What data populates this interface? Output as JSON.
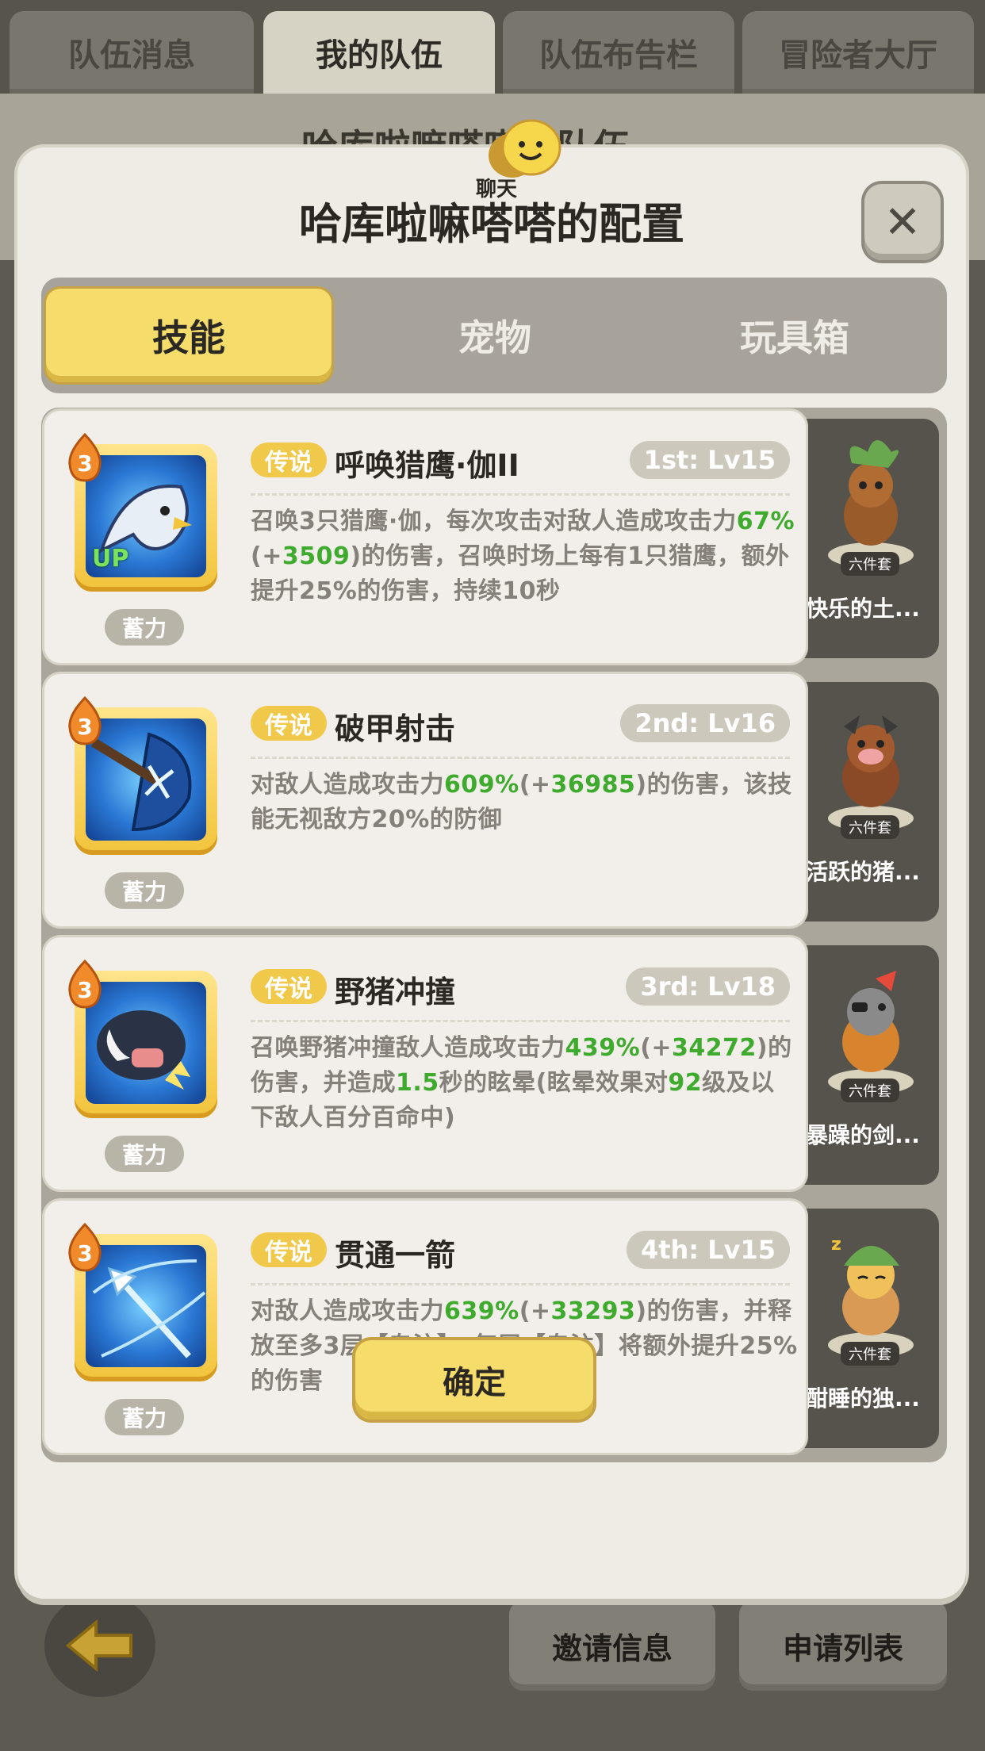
{
  "top_tabs": [
    "队伍消息",
    "我的队伍",
    "队伍布告栏",
    "冒险者大厅"
  ],
  "background": {
    "title": "哈库啦嘛嗒嗒的队伍",
    "invite_label": "邀请信息",
    "apply_label": "申请列表"
  },
  "modal": {
    "title": "哈库啦嘛嗒嗒的配置",
    "chat_label": "聊天",
    "tabs": [
      "技能",
      "宠物",
      "玩具箱"
    ],
    "confirm_label": "确定",
    "skills": [
      {
        "level": "3",
        "rarity": "传说",
        "name": "呼唤猎鹰·伽II",
        "slot": "1st: Lv15",
        "charge": "蓄力",
        "icon_badge": "UP",
        "desc_parts": [
          "召唤3只猎鹰·伽，每次攻击对敌人造成攻击力",
          "67%",
          "(+",
          "3509",
          ")的伤害，召唤时场上每有1只猎鹰，额外提升25%的伤害，持续10秒"
        ],
        "pet_name": "快乐的土...",
        "pet_set": "六件套"
      },
      {
        "level": "3",
        "rarity": "传说",
        "name": "破甲射击",
        "slot": "2nd: Lv16",
        "charge": "蓄力",
        "desc_parts": [
          "对敌人造成攻击力",
          "609%",
          "(+",
          "36985",
          ")的伤害，该技能无视敌方20%的防御"
        ],
        "pet_name": "活跃的猪...",
        "pet_set": "六件套"
      },
      {
        "level": "3",
        "rarity": "传说",
        "name": "野猪冲撞",
        "slot": "3rd: Lv18",
        "charge": "蓄力",
        "desc_parts": [
          "召唤野猪冲撞敌人造成攻击力",
          "439%",
          "(+",
          "34272",
          ")的伤害，并造成",
          "1.5",
          "秒的眩晕(眩晕效果对",
          "92",
          "级及以下敌人百分百命中)"
        ],
        "pet_name": "暴躁的剑...",
        "pet_set": "六件套"
      },
      {
        "level": "3",
        "rarity": "传说",
        "name": "贯通一箭",
        "slot": "4th: Lv15",
        "charge": "蓄力",
        "desc_parts": [
          "对敌人造成攻击力",
          "639%",
          "(+",
          "33293",
          ")的伤害，并释放至多3层【专注】，每层【专注】将额外提升25%的伤害"
        ],
        "pet_name": "酣睡的独...",
        "pet_set": "六件套"
      }
    ]
  },
  "colors": {
    "accent_yellow": "#f5dc6b",
    "highlight_green": "#3eab2f",
    "rarity_gold": "#f0c84a"
  }
}
